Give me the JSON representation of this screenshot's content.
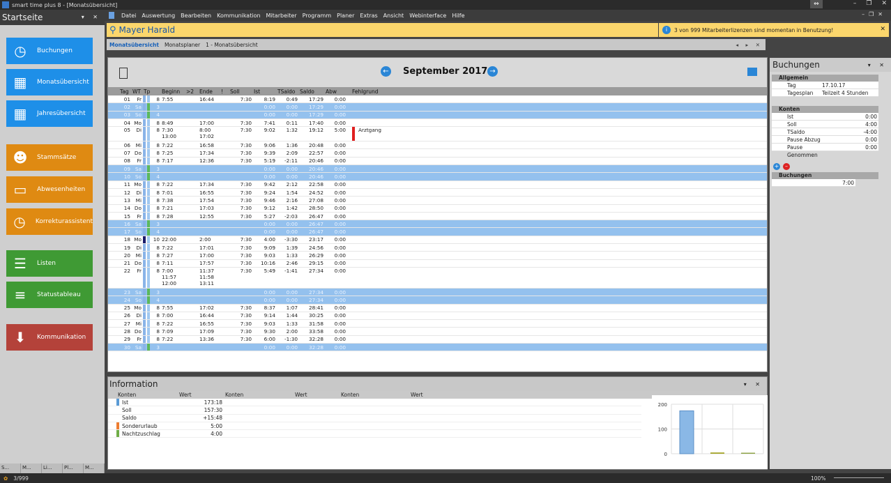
{
  "window": {
    "title": "smart time plus 8 - [Monatsübersicht]"
  },
  "menu": [
    "Datei",
    "Auswertung",
    "Bearbeiten",
    "Kommunikation",
    "Mitarbeiter",
    "Programm",
    "Planer",
    "Extras",
    "Ansicht",
    "Webinterface",
    "Hilfe"
  ],
  "sidebar": {
    "title": "Startseite",
    "buttons": [
      {
        "label": "Buchungen",
        "color": "blue",
        "icon": "clock-icon"
      },
      {
        "label": "Monatsübersicht",
        "color": "blue",
        "icon": "calendar-month-icon"
      },
      {
        "label": "Jahresübersicht",
        "color": "blue",
        "icon": "calendar-year-icon"
      },
      {
        "label": "Stammsätze",
        "color": "orange",
        "icon": "users-icon"
      },
      {
        "label": "Abwesenheiten",
        "color": "orange",
        "icon": "briefcase-icon"
      },
      {
        "label": "Korrekturassistent",
        "color": "orange",
        "icon": "clock-edit-icon"
      },
      {
        "label": "Listen",
        "color": "green",
        "icon": "list-icon"
      },
      {
        "label": "Statustableau",
        "color": "green",
        "icon": "status-list-icon"
      },
      {
        "label": "Kommunikation",
        "color": "red",
        "icon": "download-icon"
      }
    ],
    "tabs": [
      "S...",
      "M...",
      "Li...",
      "Pl...",
      "M..."
    ]
  },
  "search": {
    "name": "Mayer Harald"
  },
  "notice": {
    "text": "3 von 999 Mitarbeiterlizenzen sind momentan in Benutzung!"
  },
  "breadcrumb": {
    "active": "Monatsübersicht",
    "items": [
      "Monatsplaner",
      "1 - Monatsübersicht"
    ]
  },
  "month": {
    "title": "September 2017",
    "columns": [
      "Tag",
      "WT",
      "Tp",
      "Beginn",
      ">2",
      "Ende",
      "!",
      "Soll",
      "Ist",
      "TSaldo",
      "Saldo",
      "Abw",
      "Fehlgrund"
    ],
    "rows": [
      {
        "tag": "01",
        "wt": "Fr",
        "tp": "8",
        "beginn": [
          "7:55"
        ],
        "ende": [
          "16:44"
        ],
        "soll": "7:30",
        "ist": "8:19",
        "ts": "0:49",
        "saldo": "17:29",
        "abw": "0:00",
        "fg": "",
        "we": false
      },
      {
        "tag": "02",
        "wt": "Sa",
        "tp": "3",
        "beginn": [],
        "ende": [],
        "soll": "",
        "ist": "0:00",
        "ts": "0:00",
        "saldo": "17:29",
        "abw": "0:00",
        "fg": "",
        "we": true
      },
      {
        "tag": "03",
        "wt": "So",
        "tp": "4",
        "beginn": [],
        "ende": [],
        "soll": "",
        "ist": "0:00",
        "ts": "0:00",
        "saldo": "17:29",
        "abw": "0:00",
        "fg": "",
        "we": true
      },
      {
        "tag": "04",
        "wt": "Mo",
        "tp": "8",
        "beginn": [
          "8:49"
        ],
        "ende": [
          "17:00"
        ],
        "soll": "7:30",
        "ist": "7:41",
        "ts": "0:11",
        "saldo": "17:40",
        "abw": "0:00",
        "fg": "",
        "we": false
      },
      {
        "tag": "05",
        "wt": "Di",
        "tp": "8",
        "beginn": [
          "7:30",
          "13:00"
        ],
        "ende": [
          "8:00",
          "17:02"
        ],
        "soll": "7:30",
        "ist": "9:02",
        "ts": "1:32",
        "saldo": "19:12",
        "abw": "5:00",
        "fg": "Arztgang",
        "we": false
      },
      {
        "tag": "06",
        "wt": "Mi",
        "tp": "8",
        "beginn": [
          "7:22"
        ],
        "ende": [
          "16:58"
        ],
        "soll": "7:30",
        "ist": "9:06",
        "ts": "1:36",
        "saldo": "20:48",
        "abw": "0:00",
        "fg": "",
        "we": false
      },
      {
        "tag": "07",
        "wt": "Do",
        "tp": "8",
        "beginn": [
          "7:25"
        ],
        "ende": [
          "17:34"
        ],
        "soll": "7:30",
        "ist": "9:39",
        "ts": "2:09",
        "saldo": "22:57",
        "abw": "0:00",
        "fg": "",
        "we": false
      },
      {
        "tag": "08",
        "wt": "Fr",
        "tp": "8",
        "beginn": [
          "7:17"
        ],
        "ende": [
          "12:36"
        ],
        "soll": "7:30",
        "ist": "5:19",
        "ts": "-2:11",
        "saldo": "20:46",
        "abw": "0:00",
        "fg": "",
        "we": false
      },
      {
        "tag": "09",
        "wt": "Sa",
        "tp": "3",
        "beginn": [],
        "ende": [],
        "soll": "",
        "ist": "0:00",
        "ts": "0:00",
        "saldo": "20:46",
        "abw": "0:00",
        "fg": "",
        "we": true
      },
      {
        "tag": "10",
        "wt": "So",
        "tp": "4",
        "beginn": [],
        "ende": [],
        "soll": "",
        "ist": "0:00",
        "ts": "0:00",
        "saldo": "20:46",
        "abw": "0:00",
        "fg": "",
        "we": true
      },
      {
        "tag": "11",
        "wt": "Mo",
        "tp": "8",
        "beginn": [
          "7:22"
        ],
        "ende": [
          "17:34"
        ],
        "soll": "7:30",
        "ist": "9:42",
        "ts": "2:12",
        "saldo": "22:58",
        "abw": "0:00",
        "fg": "",
        "we": false
      },
      {
        "tag": "12",
        "wt": "Di",
        "tp": "8",
        "beginn": [
          "7:01"
        ],
        "ende": [
          "16:55"
        ],
        "soll": "7:30",
        "ist": "9:24",
        "ts": "1:54",
        "saldo": "24:52",
        "abw": "0:00",
        "fg": "",
        "we": false
      },
      {
        "tag": "13",
        "wt": "Mi",
        "tp": "8",
        "beginn": [
          "7:38"
        ],
        "ende": [
          "17:54"
        ],
        "soll": "7:30",
        "ist": "9:46",
        "ts": "2:16",
        "saldo": "27:08",
        "abw": "0:00",
        "fg": "",
        "we": false
      },
      {
        "tag": "14",
        "wt": "Do",
        "tp": "8",
        "beginn": [
          "7:21"
        ],
        "ende": [
          "17:03"
        ],
        "soll": "7:30",
        "ist": "9:12",
        "ts": "1:42",
        "saldo": "28:50",
        "abw": "0:00",
        "fg": "",
        "we": false
      },
      {
        "tag": "15",
        "wt": "Fr",
        "tp": "8",
        "beginn": [
          "7:28"
        ],
        "ende": [
          "12:55"
        ],
        "soll": "7:30",
        "ist": "5:27",
        "ts": "-2:03",
        "saldo": "26:47",
        "abw": "0:00",
        "fg": "",
        "we": false
      },
      {
        "tag": "16",
        "wt": "Sa",
        "tp": "3",
        "beginn": [],
        "ende": [],
        "soll": "",
        "ist": "0:00",
        "ts": "0:00",
        "saldo": "26:47",
        "abw": "0:00",
        "fg": "",
        "we": true
      },
      {
        "tag": "17",
        "wt": "So",
        "tp": "4",
        "beginn": [],
        "ende": [],
        "soll": "",
        "ist": "0:00",
        "ts": "0:00",
        "saldo": "26:47",
        "abw": "0:00",
        "fg": "",
        "we": true
      },
      {
        "tag": "18",
        "wt": "Mo",
        "tp": "10",
        "beginn": [
          "22:00"
        ],
        "ende": [
          "2:00"
        ],
        "soll": "7:30",
        "ist": "4:00",
        "ts": "-3:30",
        "saldo": "23:17",
        "abw": "0:00",
        "fg": "",
        "we": false,
        "night": true
      },
      {
        "tag": "19",
        "wt": "Di",
        "tp": "8",
        "beginn": [
          "7:22"
        ],
        "ende": [
          "17:01"
        ],
        "soll": "7:30",
        "ist": "9:09",
        "ts": "1:39",
        "saldo": "24:56",
        "abw": "0:00",
        "fg": "",
        "we": false
      },
      {
        "tag": "20",
        "wt": "Mi",
        "tp": "8",
        "beginn": [
          "7:27"
        ],
        "ende": [
          "17:00"
        ],
        "soll": "7:30",
        "ist": "9:03",
        "ts": "1:33",
        "saldo": "26:29",
        "abw": "0:00",
        "fg": "",
        "we": false
      },
      {
        "tag": "21",
        "wt": "Do",
        "tp": "8",
        "beginn": [
          "7:11"
        ],
        "ende": [
          "17:57"
        ],
        "soll": "7:30",
        "ist": "10:16",
        "ts": "2:46",
        "saldo": "29:15",
        "abw": "0:00",
        "fg": "",
        "we": false
      },
      {
        "tag": "22",
        "wt": "Fr",
        "tp": "8",
        "beginn": [
          "7:00",
          "11:57",
          "12:00"
        ],
        "ende": [
          "11:37",
          "11:58",
          "13:11"
        ],
        "soll": "7:30",
        "ist": "5:49",
        "ts": "-1:41",
        "saldo": "27:34",
        "abw": "0:00",
        "fg": "",
        "we": false
      },
      {
        "tag": "23",
        "wt": "Sa",
        "tp": "3",
        "beginn": [],
        "ende": [],
        "soll": "",
        "ist": "0:00",
        "ts": "0:00",
        "saldo": "27:34",
        "abw": "0:00",
        "fg": "",
        "we": true
      },
      {
        "tag": "24",
        "wt": "So",
        "tp": "4",
        "beginn": [],
        "ende": [],
        "soll": "",
        "ist": "0:00",
        "ts": "0:00",
        "saldo": "27:34",
        "abw": "0:00",
        "fg": "",
        "we": true
      },
      {
        "tag": "25",
        "wt": "Mo",
        "tp": "8",
        "beginn": [
          "7:55"
        ],
        "ende": [
          "17:02"
        ],
        "soll": "7:30",
        "ist": "8:37",
        "ts": "1:07",
        "saldo": "28:41",
        "abw": "0:00",
        "fg": "",
        "we": false
      },
      {
        "tag": "26",
        "wt": "Di",
        "tp": "8",
        "beginn": [
          "7:00"
        ],
        "ende": [
          "16:44"
        ],
        "soll": "7:30",
        "ist": "9:14",
        "ts": "1:44",
        "saldo": "30:25",
        "abw": "0:00",
        "fg": "",
        "we": false
      },
      {
        "tag": "27",
        "wt": "Mi",
        "tp": "8",
        "beginn": [
          "7:22"
        ],
        "ende": [
          "16:55"
        ],
        "soll": "7:30",
        "ist": "9:03",
        "ts": "1:33",
        "saldo": "31:58",
        "abw": "0:00",
        "fg": "",
        "we": false
      },
      {
        "tag": "28",
        "wt": "Do",
        "tp": "8",
        "beginn": [
          "7:09"
        ],
        "ende": [
          "17:09"
        ],
        "soll": "7:30",
        "ist": "9:30",
        "ts": "2:00",
        "saldo": "33:58",
        "abw": "0:00",
        "fg": "",
        "we": false
      },
      {
        "tag": "29",
        "wt": "Fr",
        "tp": "8",
        "beginn": [
          "7:22"
        ],
        "ende": [
          "13:36"
        ],
        "soll": "7:30",
        "ist": "6:00",
        "ts": "-1:30",
        "saldo": "32:28",
        "abw": "0:00",
        "fg": "",
        "we": false
      },
      {
        "tag": "30",
        "wt": "Sa",
        "tp": "3",
        "beginn": [],
        "ende": [],
        "soll": "",
        "ist": "0:00",
        "ts": "0:00",
        "saldo": "32:28",
        "abw": "0:00",
        "fg": "",
        "we": true
      }
    ]
  },
  "bookings_panel": {
    "title": "Buchungen",
    "allgemein": {
      "title": "Allgemein",
      "items": [
        {
          "k": "Tag",
          "v": "17.10.17"
        },
        {
          "k": "Tagesplan",
          "v": "Teilzeit 4 Stunden"
        }
      ]
    },
    "konten": {
      "title": "Konten",
      "items": [
        {
          "k": "Ist",
          "v": "0:00"
        },
        {
          "k": "Soll",
          "v": "4:00"
        },
        {
          "k": "TSaldo",
          "v": "-4:00"
        },
        {
          "k": "Pause Abzug",
          "v": "0:00"
        },
        {
          "k": "Pause Genommen",
          "v": "0:00"
        }
      ]
    },
    "buchungen": {
      "title": "Buchungen",
      "time": "7:00"
    }
  },
  "info": {
    "title": "Information",
    "cols": [
      "Konten",
      "Wert",
      "Konten",
      "Wert",
      "Konten",
      "Wert"
    ],
    "rows": [
      {
        "k": "Ist",
        "v": "173:18",
        "color": "#5b9bd5"
      },
      {
        "k": "Soll",
        "v": "157:30",
        "color": ""
      },
      {
        "k": "Saldo",
        "v": "+15:48",
        "color": ""
      },
      {
        "k": "Sonderurlaub",
        "v": "5:00",
        "color": "#ed7d31"
      },
      {
        "k": "Nachtzuschlag",
        "v": "4:00",
        "color": "#70ad47"
      }
    ]
  },
  "chart_data": {
    "type": "bar",
    "categories": [
      "",
      "",
      ""
    ],
    "values": [
      173.3,
      5.0,
      4.0
    ],
    "yticks": [
      "200",
      "100",
      "0"
    ],
    "ylim": [
      0,
      200
    ]
  },
  "status": {
    "count": "3/999",
    "zoom": "100%"
  }
}
